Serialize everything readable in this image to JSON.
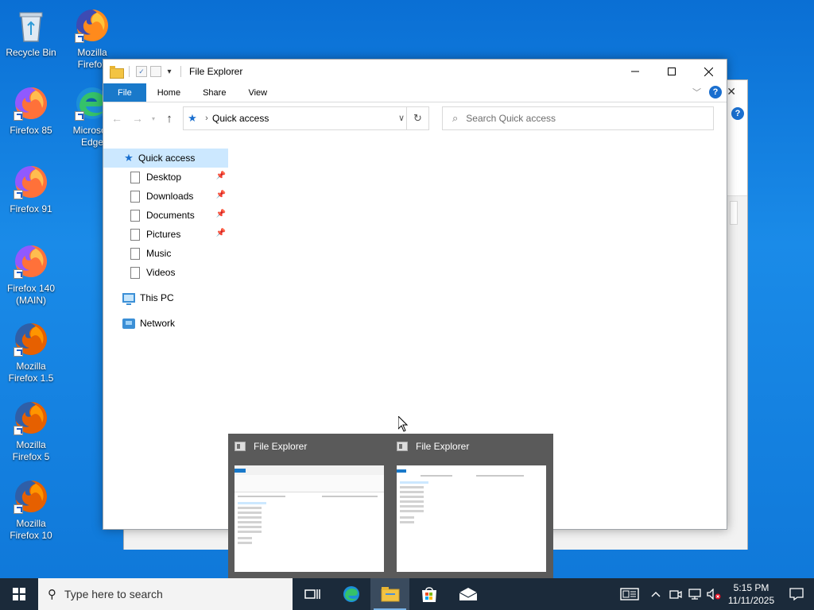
{
  "desktop": {
    "icons": [
      {
        "label": "Recycle Bin"
      },
      {
        "label": "Mozilla Firefox"
      },
      {
        "label": "Firefox 85"
      },
      {
        "label": "Microsoft Edge"
      },
      {
        "label": "Firefox 91"
      },
      {
        "label": "Firefox 140 (MAIN)"
      },
      {
        "label": "Mozilla Firefox 1.5"
      },
      {
        "label": "Mozilla Firefox 5"
      },
      {
        "label": "Mozilla Firefox 10"
      }
    ]
  },
  "explorer": {
    "title": "File Explorer",
    "ribbon_tabs": [
      "File",
      "Home",
      "Share",
      "View"
    ],
    "address": {
      "location": "Quick access"
    },
    "search": {
      "placeholder": "Search Quick access"
    },
    "nav": {
      "quick_access": "Quick access",
      "pinned": [
        "Desktop",
        "Downloads",
        "Documents",
        "Pictures"
      ],
      "unpinned": [
        "Music",
        "Videos"
      ],
      "this_pc": "This PC",
      "network": "Network"
    },
    "help_glyph": "?"
  },
  "taskbar_preview": {
    "windows": [
      {
        "title": "File Explorer"
      },
      {
        "title": "File Explorer"
      }
    ]
  },
  "taskbar": {
    "search_placeholder": "Type here to search",
    "clock": {
      "time": "5:15 PM",
      "date": "11/11/2025"
    }
  },
  "colors": {
    "accent": "#1979ca",
    "selection": "#cce8ff",
    "taskbar": "#1b2a3a",
    "desktop": "#0a6fd4"
  }
}
